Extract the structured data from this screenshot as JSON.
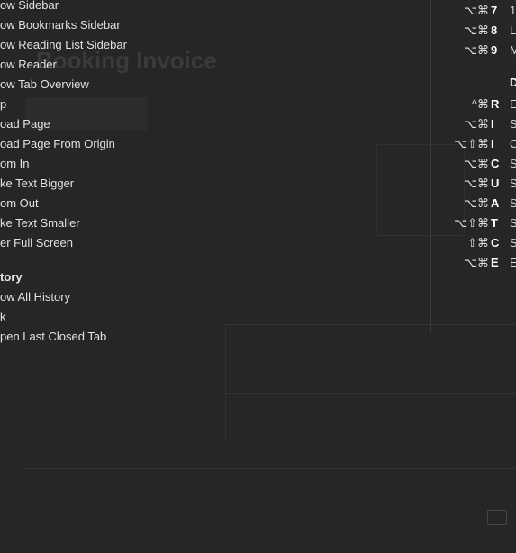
{
  "background": {
    "title": "Booking Invoice"
  },
  "menu_left": {
    "items": [
      {
        "label": "ow Sidebar"
      },
      {
        "label": "ow Bookmarks Sidebar"
      },
      {
        "label": "ow Reading List Sidebar"
      },
      {
        "label": "ow Reader"
      },
      {
        "label": "ow Tab Overview"
      },
      {
        "label": "p"
      },
      {
        "label": "oad Page"
      },
      {
        "label": "oad Page From Origin"
      },
      {
        "label": "om In"
      },
      {
        "label": "ke Text Bigger"
      },
      {
        "label": "om Out"
      },
      {
        "label": "ke Text Smaller"
      },
      {
        "label": "er Full Screen"
      }
    ],
    "section_header": "tory",
    "history_items": [
      {
        "label": "ow All History"
      },
      {
        "label": "k"
      },
      {
        "label": "pen Last Closed Tab"
      }
    ]
  },
  "menu_right": {
    "rows": [
      {
        "mods": "⌥⌘",
        "key": "7",
        "label": "1"
      },
      {
        "mods": "⌥⌘",
        "key": "8",
        "label": "L"
      },
      {
        "mods": "⌥⌘",
        "key": "9",
        "label": "M"
      },
      {
        "mods": "^⌘",
        "key": "R",
        "label": "E"
      },
      {
        "mods": "⌥⌘",
        "key": "I",
        "label": "S"
      },
      {
        "mods": "⌥⇧⌘",
        "key": "I",
        "label": "C"
      },
      {
        "mods": "⌥⌘",
        "key": "C",
        "label": "S"
      },
      {
        "mods": "⌥⌘",
        "key": "U",
        "label": "S"
      },
      {
        "mods": "⌥⌘",
        "key": "A",
        "label": "S"
      },
      {
        "mods": "⌥⇧⌘",
        "key": "T",
        "label": "S"
      },
      {
        "mods": "⇧⌘",
        "key": "C",
        "label": "S"
      },
      {
        "mods": "⌥⌘",
        "key": "E",
        "label": "E"
      }
    ],
    "section_header": "D"
  }
}
